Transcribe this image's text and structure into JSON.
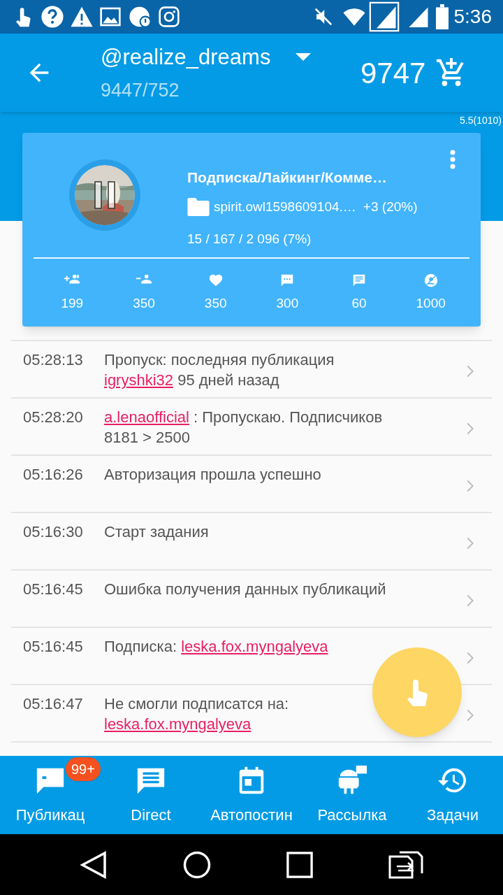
{
  "status_bar": {
    "time": "5:36"
  },
  "app_bar": {
    "account": "@realize_dreams",
    "counts": "9447/752",
    "balance": "9747"
  },
  "version": "5.5(1010)",
  "task_card": {
    "title": "Подписка/Лайкинг/Комме…",
    "source": "spirit.owl1598609104.…",
    "gain": "+3 (20%)",
    "progress": "15 / 167 / 2 096 (7%)",
    "paused": true,
    "stats": [
      {
        "kind": "follow",
        "value": "199"
      },
      {
        "kind": "unfollow",
        "value": "350"
      },
      {
        "kind": "like",
        "value": "350"
      },
      {
        "kind": "comment",
        "value": "300"
      },
      {
        "kind": "message",
        "value": "60"
      },
      {
        "kind": "limit",
        "value": "1000"
      }
    ]
  },
  "log": [
    {
      "time": "05:28:13",
      "lines": [
        [
          {
            "text": "Пропуск: последняя публикация",
            "link": false
          }
        ],
        [
          {
            "text": "igryshki32",
            "link": true
          },
          {
            "text": " 95 дней назад",
            "link": false
          }
        ]
      ]
    },
    {
      "time": "05:28:20",
      "lines": [
        [
          {
            "text": "a.lenaofficial",
            "link": true
          },
          {
            "text": " : Пропускаю. Подписчиков",
            "link": false
          }
        ],
        [
          {
            "text": "8181 > 2500",
            "link": false
          }
        ]
      ]
    },
    {
      "time": "05:16:26",
      "lines": [
        [
          {
            "text": "Авторизация прошла успешно",
            "link": false
          }
        ]
      ]
    },
    {
      "time": "05:16:30",
      "lines": [
        [
          {
            "text": "Старт задания",
            "link": false
          }
        ]
      ]
    },
    {
      "time": "05:16:45",
      "lines": [
        [
          {
            "text": "Ошибка получения данных публикаций",
            "link": false
          }
        ]
      ]
    },
    {
      "time": "05:16:45",
      "lines": [
        [
          {
            "text": "Подписка: ",
            "link": false
          },
          {
            "text": "leska.fox.myngalyeva",
            "link": true
          }
        ]
      ]
    },
    {
      "time": "05:16:47",
      "lines": [
        [
          {
            "text": "Не смогли подписатся на:",
            "link": false
          }
        ],
        [
          {
            "text": "leska.fox.myngalyeva",
            "link": true
          }
        ]
      ]
    }
  ],
  "bottom_nav": [
    {
      "kind": "posts",
      "label": "Публикац",
      "badge": "99+"
    },
    {
      "kind": "direct",
      "label": "Direct"
    },
    {
      "kind": "autopost",
      "label": "Автопостин"
    },
    {
      "kind": "mailing",
      "label": "Рассылка"
    },
    {
      "kind": "tasks",
      "label": "Задачи"
    }
  ]
}
